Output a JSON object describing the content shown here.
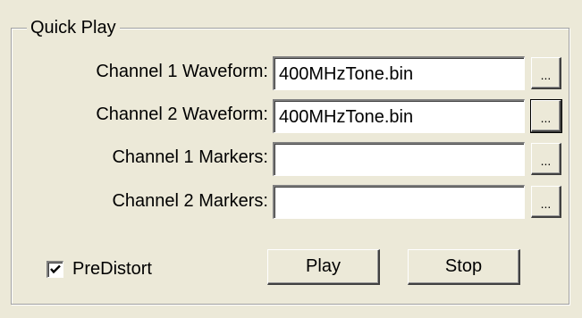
{
  "group": {
    "title": "Quick Play"
  },
  "rows": [
    {
      "label": "Channel 1 Waveform:",
      "value": "400MHzTone.bin",
      "browse_label": "..."
    },
    {
      "label": "Channel 2 Waveform:",
      "value": "400MHzTone.bin",
      "browse_label": "..."
    },
    {
      "label": "Channel 1 Markers:",
      "value": "",
      "browse_label": "..."
    },
    {
      "label": "Channel 2 Markers:",
      "value": "",
      "browse_label": "..."
    }
  ],
  "predistort": {
    "label": "PreDistort",
    "checked": true
  },
  "buttons": {
    "play_label": "Play",
    "stop_label": "Stop"
  },
  "colors": {
    "panel_background": "#ece9d8",
    "field_background": "#ffffff"
  }
}
